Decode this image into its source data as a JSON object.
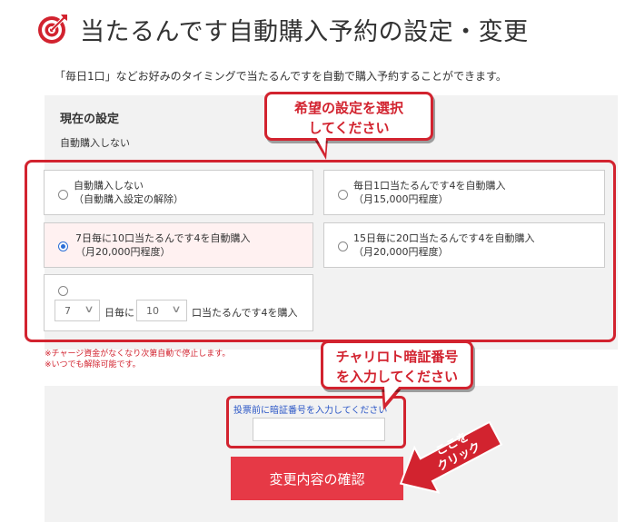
{
  "header": {
    "title": "当たるんです自動購入予約の設定・変更",
    "icon": "target-icon",
    "accent": "#d2232f"
  },
  "intro": "「毎日1口」などお好みのタイミングで当たるんですを自動で購入予約することができます。",
  "current": {
    "heading": "現在の設定",
    "value": "自動購入しない"
  },
  "options": [
    {
      "line1": "自動購入しない",
      "line2": "（自動購入設定の解除）",
      "selected": false
    },
    {
      "line1": "毎日1口当たるんです4を自動購入",
      "line2": "（月15,000円程度）",
      "selected": false
    },
    {
      "line1": "7日毎に10口当たるんです4を自動購入",
      "line2": "（月20,000円程度）",
      "selected": true
    },
    {
      "line1": "15日毎に20口当たるんです4を自動購入",
      "line2": "（月20,000円程度）",
      "selected": false
    }
  ],
  "custom": {
    "days_value": "7",
    "days_suffix": "日毎に",
    "units_value": "10",
    "units_suffix": "口当たるんです4を購入"
  },
  "notes": [
    "※チャージ資金がなくなり次第自動で停止します。",
    "※いつでも解除可能です。"
  ],
  "pin": {
    "label": "投票前に暗証番号を入力してください",
    "placeholder": ""
  },
  "confirm_button": "変更内容の確認",
  "callouts": {
    "select": [
      "希望の設定を選択",
      "してください"
    ],
    "pin": [
      "チャリロト暗証番号",
      "を入力してください"
    ],
    "click": [
      "ここを",
      "クリック"
    ]
  }
}
